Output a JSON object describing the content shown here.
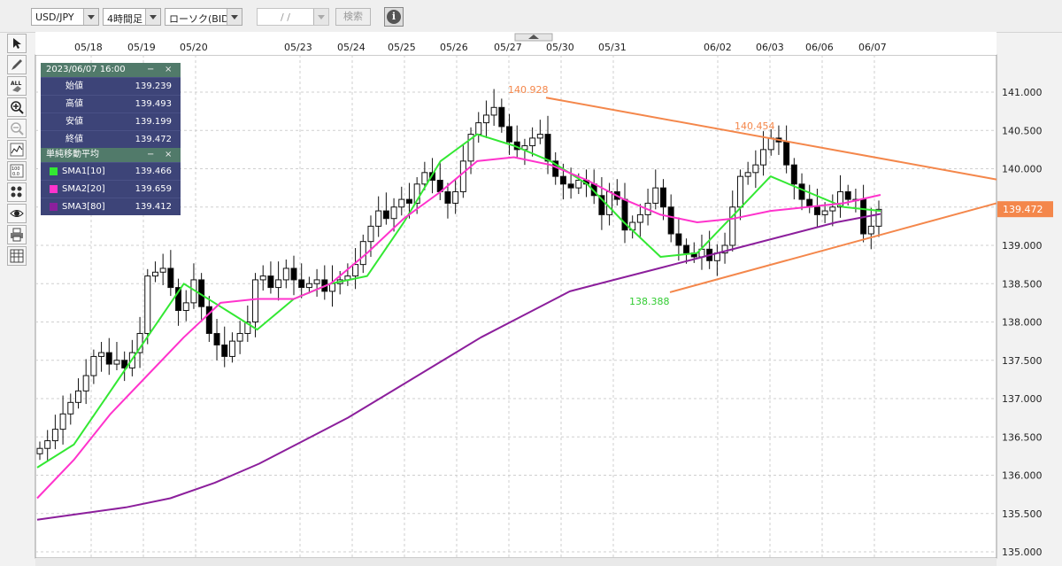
{
  "toolbar": {
    "pair": "USD/JPY",
    "period": "4時間足",
    "chart_kind": "ローソク(BID)",
    "date_value": "/    /",
    "search_label": "検索",
    "info_label": "i"
  },
  "side_tools": [
    "cursor-icon",
    "pencil-icon",
    "eraser-all-icon",
    "zoom-in-icon",
    "zoom-out-icon",
    "indicator-icon",
    "data-table-icon",
    "palette-icon",
    "eye-icon",
    "print-icon",
    "grid-settings-icon"
  ],
  "tools_text": {
    "all": "ALL",
    "data": "100\n0.0"
  },
  "info_panel": {
    "datetime": "2023/06/07 16:00",
    "minimize": "−",
    "close": "×",
    "ohlc": [
      {
        "label": "始値",
        "value": "139.239"
      },
      {
        "label": "高値",
        "value": "139.493"
      },
      {
        "label": "安値",
        "value": "139.199"
      },
      {
        "label": "終値",
        "value": "139.472"
      }
    ],
    "sma_title": "単純移動平均",
    "sma": [
      {
        "label": "SMA1[10]",
        "value": "139.466",
        "color": "#33e833"
      },
      {
        "label": "SMA2[20]",
        "value": "139.659",
        "color": "#ff33cc"
      },
      {
        "label": "SMA3[80]",
        "value": "139.412",
        "color": "#8c1f9c"
      }
    ]
  },
  "chart_data": {
    "type": "candlestick",
    "x_labels": [
      "05/18",
      "05/19",
      "05/20",
      "05/23",
      "05/24",
      "05/25",
      "05/26",
      "05/27",
      "05/30",
      "05/31",
      "06/02",
      "06/03",
      "06/06",
      "06/07"
    ],
    "y_ticks": [
      "141.000",
      "140.500",
      "140.000",
      "139.500",
      "139.000",
      "138.500",
      "138.000",
      "137.500",
      "137.000",
      "136.500",
      "136.000",
      "135.500",
      "135.000"
    ],
    "ylim": [
      135.0,
      141.0
    ],
    "grid": true,
    "current_price": "139.472",
    "annotations": [
      {
        "text": "140.928",
        "color": "#f4874b"
      },
      {
        "text": "140.454",
        "color": "#f4874b"
      },
      {
        "text": "138.388",
        "color": "#33cc33"
      }
    ],
    "trendlines": [
      {
        "name": "upper",
        "from": 140.928,
        "to": 139.86,
        "color": "#f4874b"
      },
      {
        "name": "lower",
        "from": 138.388,
        "to": 139.55,
        "color": "#f4874b"
      }
    ],
    "closes": [
      136.35,
      136.45,
      136.6,
      136.8,
      136.95,
      137.1,
      137.3,
      137.55,
      137.6,
      137.45,
      137.5,
      137.4,
      137.6,
      137.85,
      138.6,
      138.65,
      138.7,
      138.45,
      138.15,
      138.25,
      138.55,
      138.2,
      137.85,
      137.7,
      137.55,
      137.75,
      137.85,
      138.0,
      138.55,
      138.6,
      138.45,
      138.55,
      138.7,
      138.55,
      138.45,
      138.5,
      138.55,
      138.4,
      138.5,
      138.55,
      138.6,
      138.75,
      139.05,
      139.25,
      139.45,
      139.35,
      139.5,
      139.6,
      139.55,
      139.8,
      139.95,
      139.85,
      139.7,
      139.55,
      139.7,
      140.1,
      140.45,
      140.6,
      140.7,
      140.8,
      140.55,
      140.35,
      140.25,
      140.3,
      140.4,
      140.45,
      140.1,
      139.9,
      139.8,
      139.75,
      139.85,
      139.8,
      139.65,
      139.4,
      139.7,
      139.6,
      139.2,
      139.3,
      139.4,
      139.55,
      139.75,
      139.5,
      139.15,
      139.0,
      138.9,
      138.85,
      138.95,
      138.8,
      138.9,
      139.0,
      139.5,
      139.9,
      139.95,
      140.05,
      140.25,
      140.4,
      140.35,
      140.05,
      139.8,
      139.6,
      139.5,
      139.4,
      139.45,
      139.5,
      139.7,
      139.6,
      139.6,
      139.15,
      139.25,
      139.47
    ],
    "series": [
      {
        "name": "SMA1[10]",
        "color": "#33e833",
        "values": [
          136.1,
          136.4,
          137.1,
          137.8,
          138.5,
          138.2,
          137.9,
          138.3,
          138.5,
          138.6,
          139.3,
          140.1,
          140.45,
          140.3,
          140.1,
          139.8,
          139.3,
          138.85,
          138.9,
          139.4,
          139.9,
          139.7,
          139.5,
          139.45
        ]
      },
      {
        "name": "SMA2[20]",
        "color": "#ff33cc",
        "values": [
          135.7,
          136.2,
          136.8,
          137.3,
          137.8,
          138.25,
          138.3,
          138.3,
          138.5,
          138.9,
          139.35,
          139.7,
          140.1,
          140.15,
          140.05,
          139.85,
          139.6,
          139.4,
          139.3,
          139.35,
          139.45,
          139.5,
          139.55,
          139.659
        ]
      },
      {
        "name": "SMA3[80]",
        "color": "#8c1f9c",
        "values": [
          135.42,
          135.5,
          135.58,
          135.7,
          135.9,
          136.15,
          136.45,
          136.75,
          137.1,
          137.45,
          137.8,
          138.1,
          138.4,
          138.55,
          138.7,
          138.85,
          139.0,
          139.15,
          139.3,
          139.41
        ]
      }
    ]
  }
}
